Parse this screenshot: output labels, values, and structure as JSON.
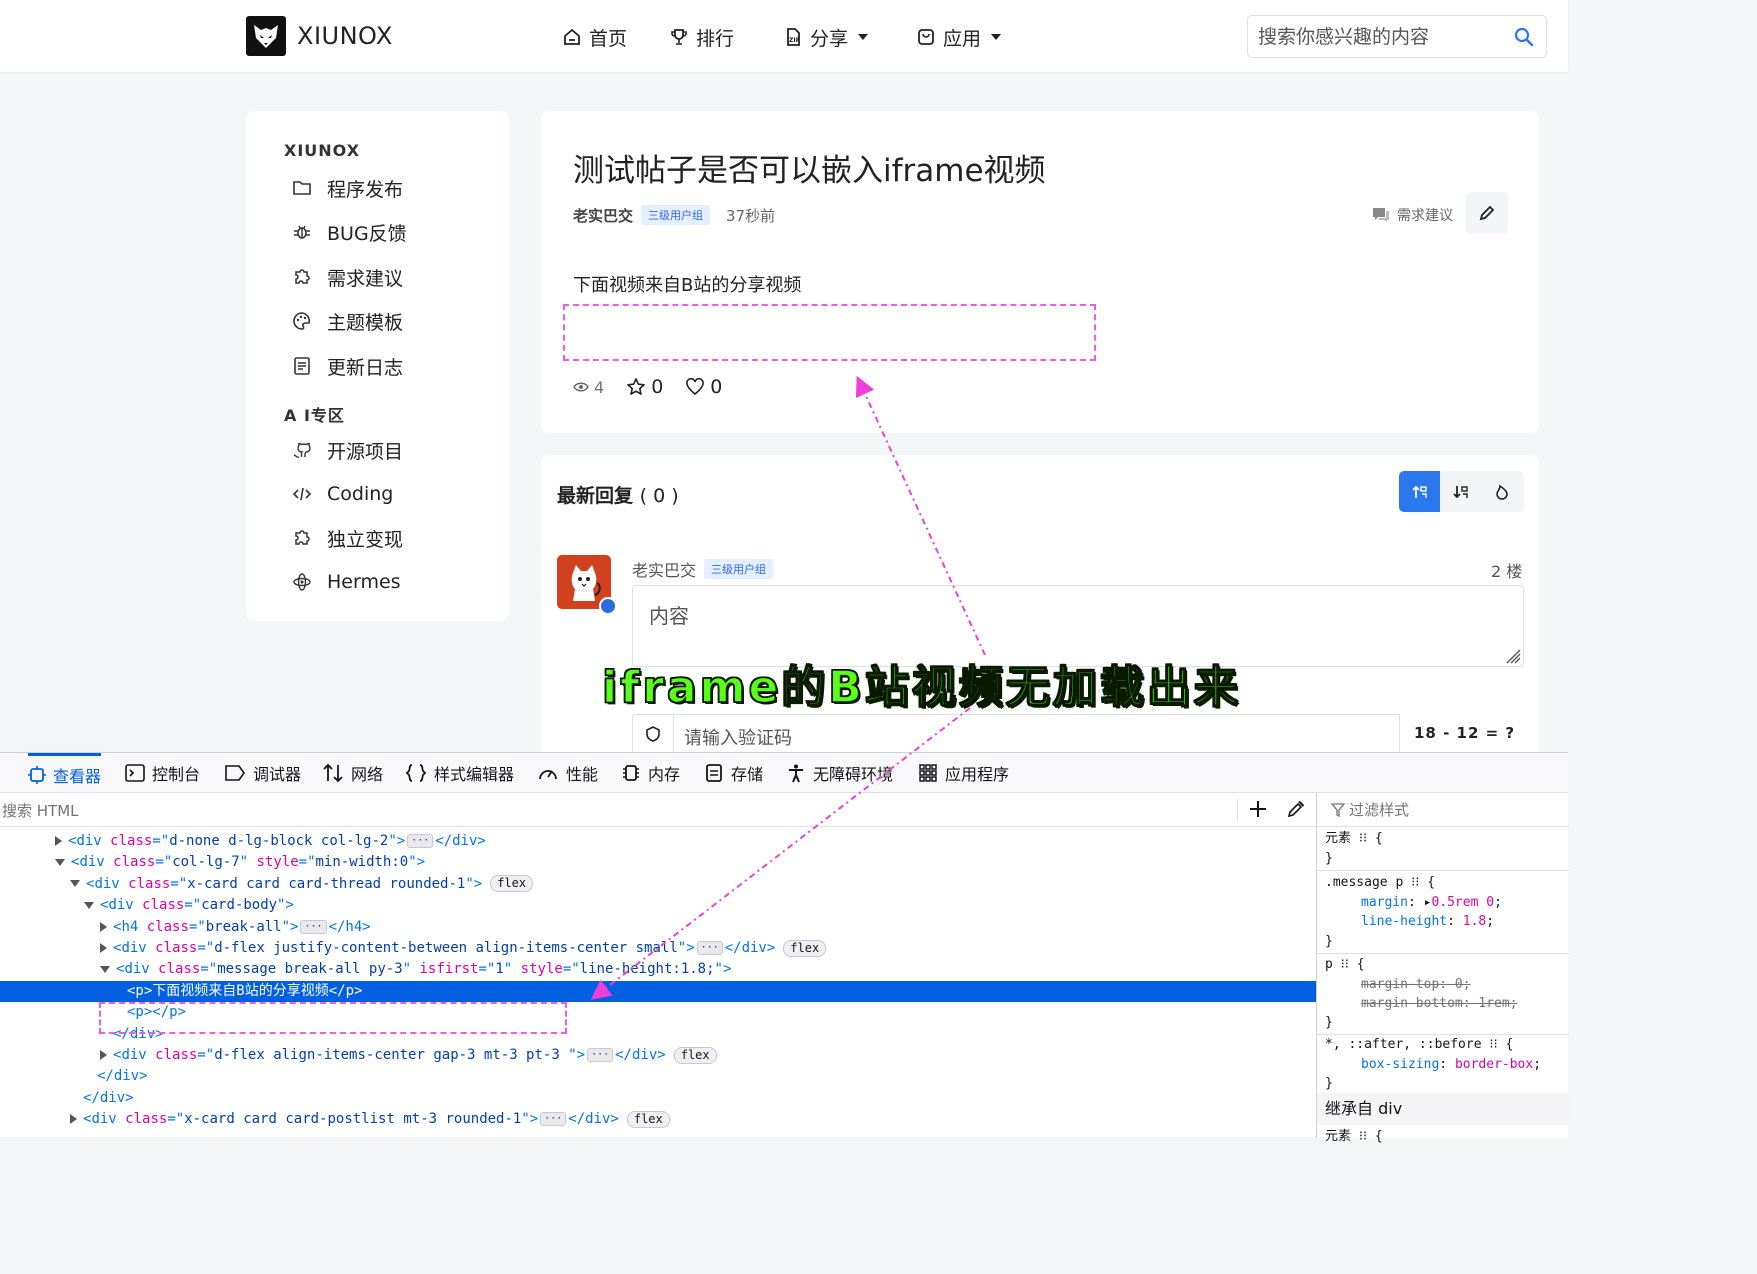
{
  "header": {
    "brand": "XIUNOX",
    "nav": [
      {
        "label": "首页",
        "icon": "home-icon"
      },
      {
        "label": "排行",
        "icon": "trophy-icon"
      },
      {
        "label": "分享",
        "icon": "zip-file-icon",
        "dropdown": true
      },
      {
        "label": "应用",
        "icon": "app-icon",
        "dropdown": true
      }
    ],
    "search_placeholder": "搜索你感兴趣的内容"
  },
  "sidebar": {
    "section1_title": "XIUNOX",
    "section1_items": [
      {
        "label": "程序发布",
        "icon": "folder-icon"
      },
      {
        "label": "BUG反馈",
        "icon": "bug-icon"
      },
      {
        "label": "需求建议",
        "icon": "puzzle-icon"
      },
      {
        "label": "主题模板",
        "icon": "palette-icon"
      },
      {
        "label": "更新日志",
        "icon": "document-icon"
      }
    ],
    "section2_title": "A I专区",
    "section2_items": [
      {
        "label": "开源项目",
        "icon": "github-icon"
      },
      {
        "label": "Coding",
        "icon": "code-icon"
      },
      {
        "label": "独立变现",
        "icon": "puzzle-icon"
      },
      {
        "label": "Hermes",
        "icon": "atom-icon"
      }
    ]
  },
  "post": {
    "title": "测试帖子是否可以嵌入iframe视频",
    "author": "老实巴交",
    "badge": "三级用户组",
    "time": "37秒前",
    "category": "需求建议",
    "body": "下面视频来自B站的分享视频",
    "views": "4",
    "stars": "0",
    "likes": "0"
  },
  "replies": {
    "title": "最新回复",
    "count": "( 0 )",
    "author": "老实巴交",
    "badge": "三级用户组",
    "floor": "2 楼",
    "textarea_placeholder": "内容",
    "captcha_placeholder": "请输入验证码",
    "captcha_expr": "18 - 12 = ?"
  },
  "annotation": {
    "text": "iframe的B站视频无加载出来",
    "color": "#5aff19",
    "highlight_color": "#ee5ce6"
  },
  "devtools": {
    "tabs": [
      {
        "label": "查看器",
        "icon": "inspector-icon"
      },
      {
        "label": "控制台",
        "icon": "console-icon"
      },
      {
        "label": "调试器",
        "icon": "debugger-icon"
      },
      {
        "label": "网络",
        "icon": "network-icon"
      },
      {
        "label": "样式编辑器",
        "icon": "braces-icon"
      },
      {
        "label": "性能",
        "icon": "gauge-icon"
      },
      {
        "label": "内存",
        "icon": "memory-icon"
      },
      {
        "label": "存储",
        "icon": "storage-icon"
      },
      {
        "label": "无障碍环境",
        "icon": "accessibility-icon"
      },
      {
        "label": "应用程序",
        "icon": "grid-icon"
      }
    ],
    "search_placeholder": "搜索 HTML",
    "filter_placeholder": "过滤样式",
    "tree": {
      "l1": {
        "tag": "div",
        "attr": "class",
        "val": "d-none d-lg-block col-lg-2"
      },
      "l2": {
        "tag": "div",
        "attr1": "class",
        "val1": "col-lg-7",
        "attr2": "style",
        "val2": "min-width:0"
      },
      "l3": {
        "tag": "div",
        "attr": "class",
        "val": "x-card card card-thread rounded-1"
      },
      "l4": {
        "tag": "div",
        "attr": "class",
        "val": "card-body"
      },
      "l5": {
        "tag": "h4",
        "attr": "class",
        "val": "break-all"
      },
      "l6": {
        "tag": "div",
        "attr": "class",
        "val": "d-flex justify-content-between align-items-center small"
      },
      "l7": {
        "tag": "div",
        "attr1": "class",
        "val1": "message break-all py-3",
        "attr2": "isfirst",
        "val2": "1",
        "attr3": "style",
        "val3": "line-height:1.8;"
      },
      "l8": {
        "text": "下面视频来自B站的分享视频"
      },
      "l10": {
        "tag": "div",
        "attr": "class",
        "val": "d-flex align-items-center gap-3 mt-3 pt-3 "
      },
      "l13": {
        "tag": "div",
        "attr": "class",
        "val": "x-card card card-postlist mt-3 rounded-1"
      },
      "flex_badge": "flex"
    },
    "styles": {
      "element_rule": "元素",
      "rule1_selector": ".message p",
      "rule1_prop1": "margin",
      "rule1_val1": "0.5rem 0",
      "rule1_prop2": "line-height",
      "rule1_val2": "1.8",
      "rule2_selector": "p",
      "rule2_prop1": "margin-top: 0;",
      "rule2_prop2": "margin-bottom: 1rem;",
      "rule3_selector": "*, ::after, ::before",
      "rule3_prop": "box-sizing",
      "rule3_val": "border-box",
      "inherited": "继承自 div",
      "element_rule2": "元素"
    }
  }
}
